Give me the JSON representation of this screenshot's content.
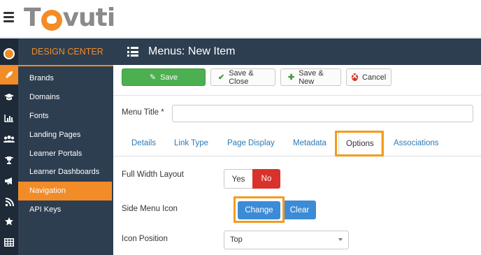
{
  "app": {
    "logo_text_left": "T",
    "logo_text_right": "vuti"
  },
  "rail": {
    "items": [
      "avatar-icon",
      "rocket-icon",
      "graduation-cap-icon",
      "bar-chart-icon",
      "users-icon",
      "trophy-icon",
      "bullhorn-icon",
      "rss-icon",
      "star-icon",
      "table-icon"
    ],
    "active_index": 1
  },
  "sidebar": {
    "header": "DESIGN CENTER",
    "items": [
      {
        "label": "Brands"
      },
      {
        "label": "Domains"
      },
      {
        "label": "Fonts"
      },
      {
        "label": "Landing Pages"
      },
      {
        "label": "Learner Portals"
      },
      {
        "label": "Learner Dashboards"
      },
      {
        "label": "Navigation"
      },
      {
        "label": "API Keys"
      }
    ],
    "active_index": 6
  },
  "header": {
    "title": "Menus: New Item"
  },
  "toolbar": {
    "save_label": "Save",
    "save_close_label": "Save & Close",
    "save_new_label": "Save & New",
    "cancel_label": "Cancel"
  },
  "form": {
    "menu_title_label": "Menu Title *",
    "menu_title_value": "",
    "tabs": [
      {
        "label": "Details"
      },
      {
        "label": "Link Type"
      },
      {
        "label": "Page Display"
      },
      {
        "label": "Metadata"
      },
      {
        "label": "Options"
      },
      {
        "label": "Associations"
      }
    ],
    "active_tab_index": 4,
    "full_width_label": "Full Width Layout",
    "full_width_yes": "Yes",
    "full_width_no": "No",
    "full_width_selected": "No",
    "side_menu_icon_label": "Side Menu Icon",
    "change_label": "Change",
    "clear_label": "Clear",
    "icon_position_label": "Icon Position",
    "icon_position_value": "Top"
  },
  "colors": {
    "accent": "#f28c28",
    "sidebar_bg": "#2d3e50",
    "save_green": "#4caf50",
    "danger_red": "#d9312b",
    "primary_blue": "#3c8bd6",
    "link_blue": "#2a7ab8",
    "highlight_orange": "#f39c1e"
  }
}
